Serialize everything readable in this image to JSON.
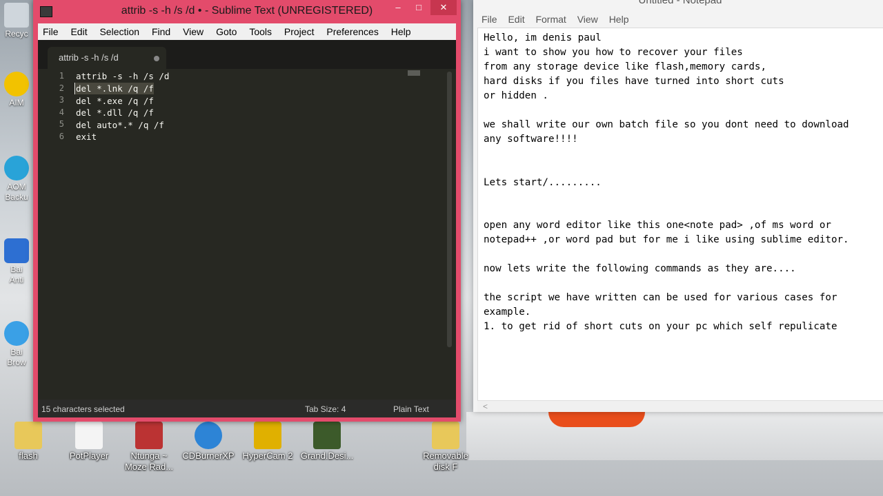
{
  "desktop": {
    "left_icons": [
      {
        "label": "Recyc",
        "top": 0
      },
      {
        "label": "AIM",
        "top": 0
      },
      {
        "label": "AOM\nBacku",
        "top": 0
      },
      {
        "label": "Bai\nAnti",
        "top": 0
      },
      {
        "label": "Bai\nBrow",
        "top": 0
      }
    ],
    "bottom_icons": [
      {
        "label": "flash"
      },
      {
        "label": "PotPlayer"
      },
      {
        "label": "Ntunga ~ Moze Rad..."
      },
      {
        "label": "CDBurnerXP"
      },
      {
        "label": "HyperCam 2"
      },
      {
        "label": "Grand.Desi..."
      },
      {
        "label": "Removable disk F"
      }
    ]
  },
  "sublime": {
    "title": "attrib -s -h /s /d • - Sublime Text (UNREGISTERED)",
    "menu": [
      "File",
      "Edit",
      "Selection",
      "Find",
      "View",
      "Goto",
      "Tools",
      "Project",
      "Preferences",
      "Help"
    ],
    "tab_label": "attrib -s -h /s /d",
    "line_numbers": [
      "1",
      "2",
      "3",
      "4",
      "5",
      "6"
    ],
    "code_lines": [
      "attrib -s -h /s /d",
      "del *.lnk /q /f",
      "del *.exe /q /f",
      "del *.dll /q /f",
      "del auto*.* /q /f",
      "exit"
    ],
    "status_left": "15 characters selected",
    "status_tab": "Tab Size: 4",
    "status_syntax": "Plain Text",
    "window_buttons": {
      "minimize": "–",
      "maximize": "□",
      "close": "✕"
    }
  },
  "notepad": {
    "title": "Untitled - Notepad",
    "menu": [
      "File",
      "Edit",
      "Format",
      "View",
      "Help"
    ],
    "lines": [
      "Hello, im denis paul",
      "i want to show you how to recover your files",
      "from any storage device like flash,memory cards,",
      "hard disks if you files have turned into short cuts",
      "or hidden .",
      "",
      "we shall write our own batch file so you dont need to download",
      "any software!!!!",
      "",
      "",
      "Lets start/.........",
      "",
      "",
      "open any word editor like this one<note pad> ,of ms word or",
      "notepad++ ,or word pad but for me i like using sublime editor.",
      "",
      "now lets write the following commands as they are....",
      "",
      "the script we have written can be used for various cases for",
      "example.",
      "1. to get rid of short cuts on your pc which self repulicate"
    ],
    "hscroll_arrow": "<"
  }
}
